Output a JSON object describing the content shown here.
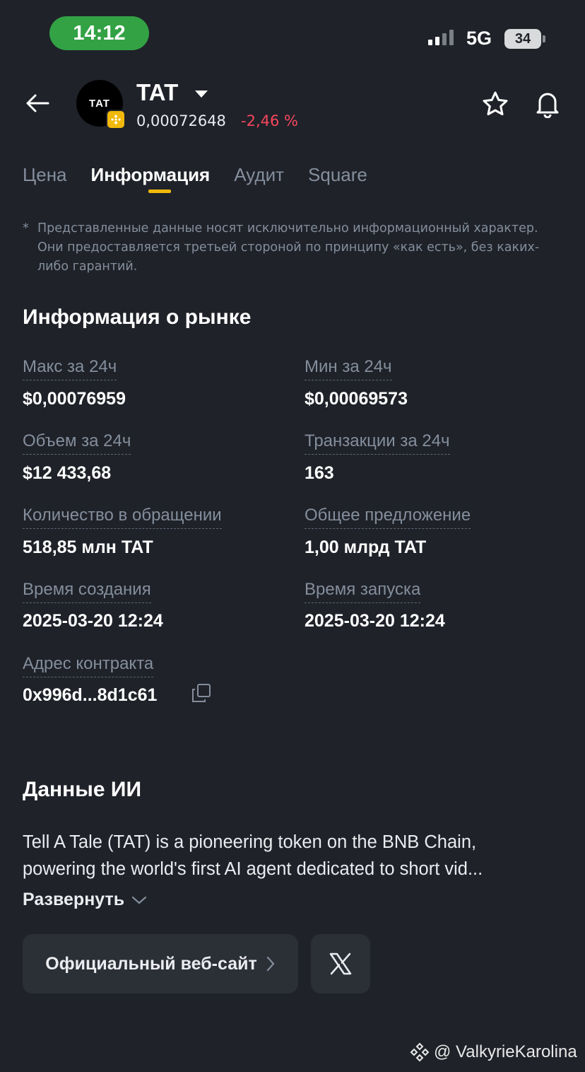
{
  "status_bar": {
    "time": "14:12",
    "network": "5G",
    "battery": "34"
  },
  "header": {
    "ticker": "TAT",
    "logo_text": "TAT",
    "price": "0,00072648",
    "change": "-2,46 %",
    "change_color": "#f6465d"
  },
  "tabs": [
    {
      "label": "Цена"
    },
    {
      "label": "Информация"
    },
    {
      "label": "Аудит"
    },
    {
      "label": "Square"
    }
  ],
  "active_tab": "Информация",
  "disclaimer": {
    "mark": "*",
    "lines": [
      "Представленные данные носят исключительно информационный характер.",
      "Они предоставляется третьей стороной по принципу «как есть», без каких-",
      "либо гарантий."
    ]
  },
  "market_info": {
    "title": "Информация о рынке",
    "fields": [
      {
        "label": "Макс за 24ч",
        "value": "$0,00076959"
      },
      {
        "label": "Мин за 24ч",
        "value": "$0,00069573"
      },
      {
        "label": "Объем за 24ч",
        "value": "$12 433,68"
      },
      {
        "label": "Транзакции за 24ч",
        "value": "163"
      },
      {
        "label": "Количество в обращении",
        "value": "518,85 млн TAT"
      },
      {
        "label": "Общее предложение",
        "value": "1,00 млрд TAT"
      },
      {
        "label": "Время создания",
        "value": "2025-03-20 12:24"
      },
      {
        "label": "Время запуска",
        "value": "2025-03-20 12:24"
      },
      {
        "label": "Адрес контракта",
        "value": "0x996d...8d1c61"
      }
    ]
  },
  "ai_data": {
    "title": "Данные ИИ",
    "lines": [
      "Tell A Tale (TAT) is a pioneering token on the BNB Chain,",
      "powering the world's first AI agent dedicated to short vid..."
    ],
    "expand_label": "Развернуть"
  },
  "links": {
    "website_label": "Официальный веб-сайт",
    "x_icon": "x-logo-icon"
  },
  "watermark": "@ ValkyrieKarolina",
  "colors": {
    "background": "#1f2229",
    "accent": "#f0b90b",
    "negative": "#f6465d",
    "muted": "#848e9c"
  }
}
